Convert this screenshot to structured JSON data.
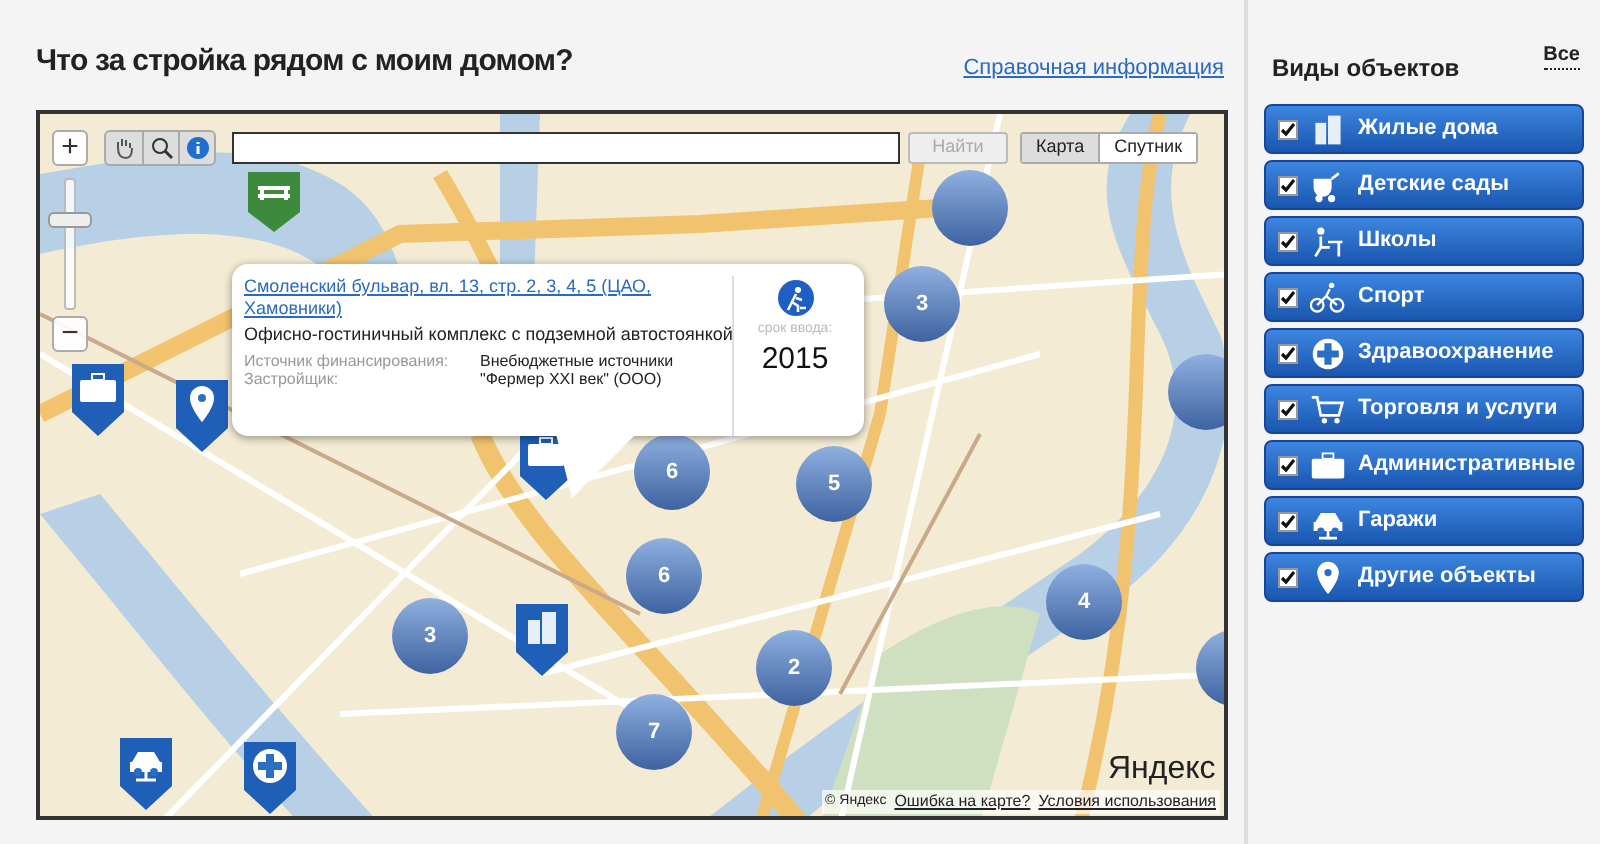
{
  "page": {
    "title": "Что за стройка рядом с моим домом?",
    "help_link": "Справочная информация"
  },
  "map": {
    "search": {
      "button": "Найти"
    },
    "map_types": [
      {
        "label": "Карта",
        "selected": true
      },
      {
        "label": "Спутник",
        "selected": false
      }
    ],
    "zoom": {
      "plus": "+",
      "minus": "−",
      "level": 0.7
    },
    "clusters": [
      {
        "label": "3"
      },
      {
        "label": "6"
      },
      {
        "label": "5"
      },
      {
        "label": "6"
      },
      {
        "label": "3"
      },
      {
        "label": "2"
      },
      {
        "label": "4"
      },
      {
        "label": "7"
      }
    ],
    "popup": {
      "address": "Смоленский бульвар, вл. 13, стр. 2, 3, 4, 5 (ЦАО, Хамовники)",
      "description": "Офисно-гостиничный комплекс с подземной автостоянкой",
      "fields": [
        {
          "label": "Источник финансирования:",
          "value": "Внебюджетные источники"
        },
        {
          "label": "Застройщик:",
          "value": "\"Фермер XXI век\" (ООО)"
        }
      ],
      "deadline_label": "срок ввода:",
      "deadline": "2015"
    },
    "logo": "Яндекс",
    "copyright": "© Яндекс",
    "footer_links": [
      "Ошибка на карте?",
      "Условия использования"
    ]
  },
  "sidebar": {
    "title": "Виды объектов",
    "all_link": "Все",
    "categories": [
      {
        "label": "Жилые дома",
        "checked": true
      },
      {
        "label": "Детские сады",
        "checked": true
      },
      {
        "label": "Школы",
        "checked": true
      },
      {
        "label": "Спорт",
        "checked": true
      },
      {
        "label": "Здравоохранение",
        "checked": true
      },
      {
        "label": "Торговля и услуги",
        "checked": true
      },
      {
        "label": "Административные",
        "checked": true
      },
      {
        "label": "Гаражи",
        "checked": true
      },
      {
        "label": "Другие объекты",
        "checked": true
      }
    ]
  }
}
